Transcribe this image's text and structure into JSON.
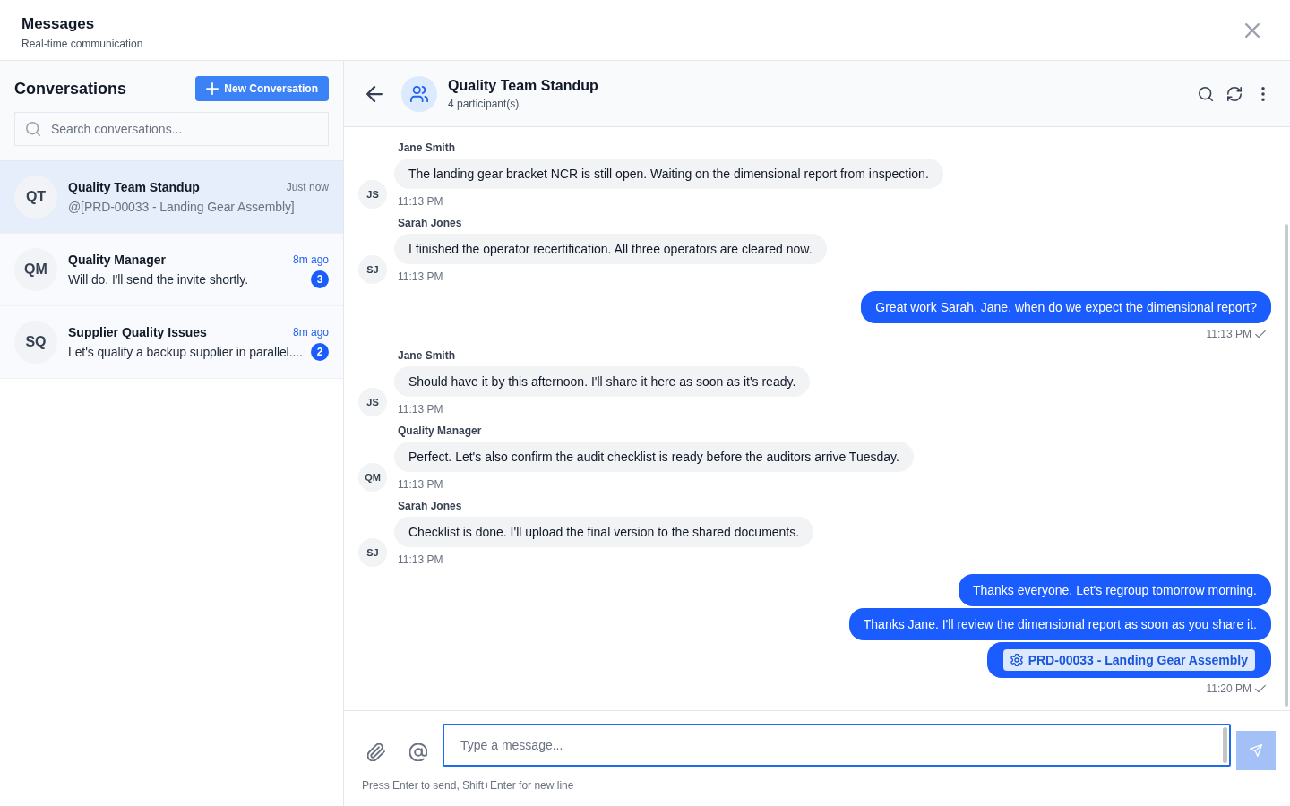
{
  "header": {
    "title": "Messages",
    "subtitle": "Real-time communication"
  },
  "sidebar": {
    "title": "Conversations",
    "new_button": "New Conversation",
    "search": {
      "placeholder": "Search conversations..."
    },
    "conversations": [
      {
        "initials": "QT",
        "name": "Quality Team Standup",
        "time": "Just now",
        "preview": "@[PRD-00033 - Landing Gear Assembly]",
        "selected": true
      },
      {
        "initials": "QM",
        "name": "Quality Manager",
        "time": "8m ago",
        "preview": "Will do. I'll send the invite shortly.",
        "unread_count": "3",
        "selected": false
      },
      {
        "initials": "SQ",
        "name": "Supplier Quality Issues",
        "time": "8m ago",
        "preview": "Let's qualify a backup supplier in parallel....",
        "unread_count": "2",
        "selected": false
      }
    ]
  },
  "chat": {
    "title": "Quality Team Standup",
    "subtitle": "4 participant(s)",
    "messages": [
      {
        "kind": "incoming",
        "sender": "Jane Smith",
        "initials": "JS",
        "bubbles": [
          {
            "kind": "text",
            "text": "The landing gear bracket NCR is still open. Waiting on the dimensional report from inspection."
          }
        ],
        "time": "11:13 PM"
      },
      {
        "kind": "incoming",
        "sender": "Sarah Jones",
        "initials": "SJ",
        "bubbles": [
          {
            "kind": "text",
            "text": "I finished the operator recertification. All three operators are cleared now."
          }
        ],
        "time": "11:13 PM"
      },
      {
        "kind": "outgoing",
        "bubbles": [
          {
            "kind": "text",
            "text": "Great work Sarah. Jane, when do we expect the dimensional report?"
          }
        ],
        "time": "11:13 PM",
        "read": true
      },
      {
        "kind": "incoming",
        "sender": "Jane Smith",
        "initials": "JS",
        "bubbles": [
          {
            "kind": "text",
            "text": "Should have it by this afternoon. I'll share it here as soon as it's ready."
          }
        ],
        "time": "11:13 PM"
      },
      {
        "kind": "incoming",
        "sender": "Quality Manager",
        "initials": "QM",
        "bubbles": [
          {
            "kind": "text",
            "text": "Perfect. Let's also confirm the audit checklist is ready before the auditors arrive Tuesday."
          }
        ],
        "time": "11:13 PM"
      },
      {
        "kind": "incoming",
        "sender": "Sarah Jones",
        "initials": "SJ",
        "bubbles": [
          {
            "kind": "text",
            "text": "Checklist is done. I'll upload the final version to the shared documents."
          }
        ],
        "time": "11:13 PM"
      },
      {
        "kind": "outgoing",
        "bubbles": [
          {
            "kind": "text",
            "text": "Thanks everyone. Let's regroup tomorrow morning."
          },
          {
            "kind": "text",
            "text": "Thanks Jane. I'll review the dimensional report as soon as you share it."
          },
          {
            "kind": "reference",
            "text": "PRD-00033 - Landing Gear Assembly"
          }
        ],
        "time": "11:20 PM",
        "read": true
      }
    ]
  },
  "composer": {
    "placeholder": "Type a message...",
    "focused": true,
    "send_disabled": true,
    "hint": "Press Enter to send, Shift+Enter for new line"
  }
}
